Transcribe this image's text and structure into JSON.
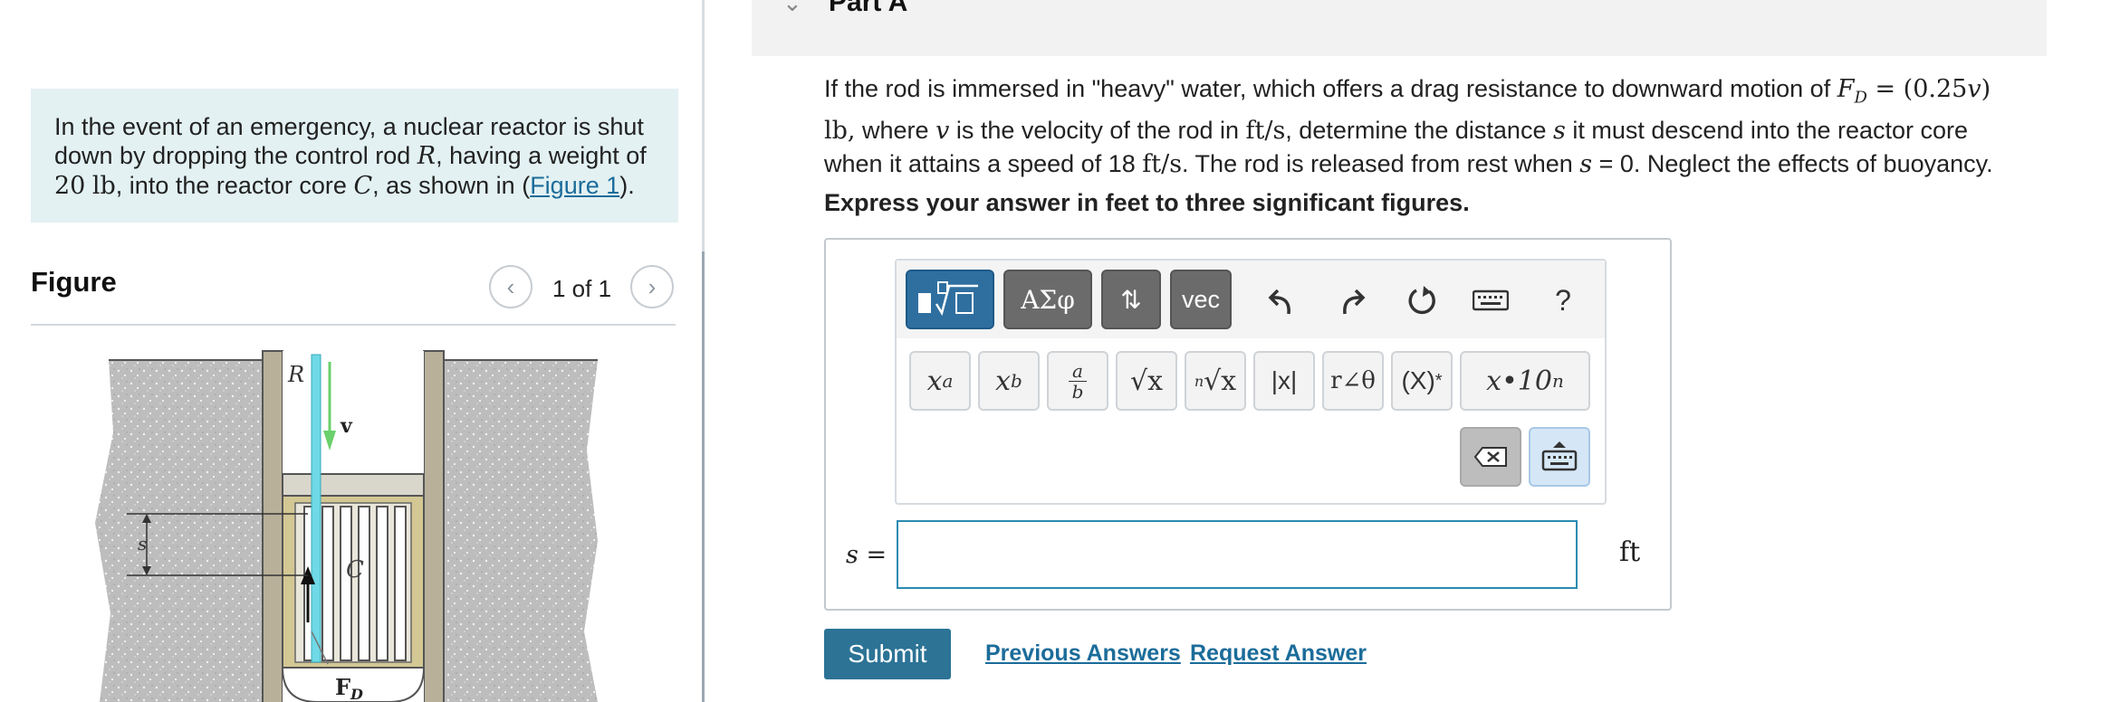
{
  "intro": {
    "t1": "In the event of an emergency, a nuclear reactor is shut down by dropping the control rod ",
    "rod": "R",
    "t2": ", having a weight of ",
    "weight_num": "20",
    "weight_unit": "lb",
    "t3": ", into the reactor core ",
    "core": "C",
    "t4": ", as shown in (",
    "figure_link": "Figure 1",
    "t5": ")."
  },
  "figure": {
    "title": "Figure",
    "counter": "1 of 1",
    "labels": {
      "rod": "R",
      "velocity": "v",
      "distance": "s",
      "core": "C",
      "drag": "F",
      "drag_sub": "D"
    }
  },
  "part": {
    "title": "Part A"
  },
  "problem": {
    "p1": "If the rod is immersed in \"heavy\" water, which offers a drag resistance to downward motion of ",
    "fd": "F",
    "fd_sub": "D",
    "eq": " = (0.25",
    "eq_v": "v",
    "eq_close": ") lb,",
    "p2": " where ",
    "v": "v",
    "p3": " is the velocity of the rod in ",
    "unit_fts": "ft/s",
    "p4": ", determine the distance ",
    "s": "s",
    "p5": " it must descend into the reactor core when it attains a speed of 18 ",
    "unit_fts2": "ft/s",
    "p6": ". The rod is released from rest when ",
    "s2": "s",
    "p7": " = 0. Neglect the effects of buoyancy."
  },
  "instruction": "Express your answer in feet to three significant figures.",
  "toolbar": {
    "templates_icon": "templates-icon",
    "greek": "ΑΣφ",
    "arrows": "⇅",
    "vec": "vec",
    "undo_icon": "undo-icon",
    "redo_icon": "redo-icon",
    "reset_icon": "reset-icon",
    "keyboard_icon": "keyboard-icon",
    "help": "?"
  },
  "keys": {
    "superscript": "x",
    "superscript_sup": "a",
    "subscript": "x",
    "subscript_sub": "b",
    "fraction_num": "a",
    "fraction_den": "b",
    "sqrt": "√x",
    "nthroot_n": "n",
    "nthroot": "√x",
    "abs": "|x|",
    "polar": "r∠θ",
    "conjugate": "(X)",
    "conjugate_sup": "*",
    "sci": "x•10",
    "sci_sup": "n"
  },
  "answer": {
    "variable": "s =",
    "value": "",
    "unit": "ft"
  },
  "actions": {
    "submit": "Submit",
    "previous_answers": "Previous Answers",
    "request_answer": "Request Answer"
  },
  "colors": {
    "intro_bg": "#e3f1f3",
    "link": "#1b6c9a",
    "submit_bg": "#2c7396",
    "input_border": "#2b8bb0",
    "active_tool": "#2f6fa0"
  }
}
